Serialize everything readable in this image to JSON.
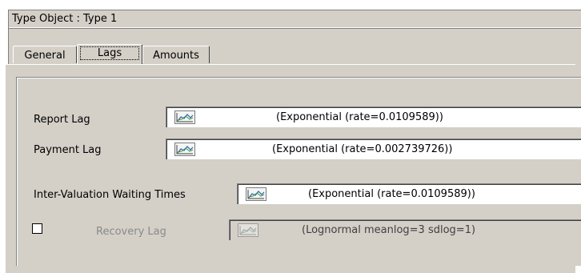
{
  "window": {
    "title": "Type Object : Type 1"
  },
  "tabs": [
    {
      "label": "General",
      "active": false
    },
    {
      "label": "Lags",
      "active": true
    },
    {
      "label": "Amounts",
      "active": false
    }
  ],
  "fields": [
    {
      "label": "Report Lag",
      "value": "(Exponential (rate=0.0109589))",
      "icon": "distribution-chart-icon",
      "enabled": true
    },
    {
      "label": "Payment Lag",
      "value": "(Exponential (rate=0.002739726))",
      "icon": "distribution-chart-icon",
      "enabled": true
    },
    {
      "label": "Inter-Valuation Waiting Times",
      "value": "(Exponential (rate=0.0109589))",
      "icon": "distribution-chart-icon",
      "enabled": true
    },
    {
      "label": "Recovery Lag",
      "value": "(Lognormal meanlog=3  sdlog=1)",
      "icon": "distribution-chart-icon",
      "enabled": false,
      "checked": false
    }
  ],
  "colors": {
    "dialog_bg": "#d4d0c8",
    "field_bg": "#ffffff",
    "disabled_text": "#8a8a8a"
  }
}
